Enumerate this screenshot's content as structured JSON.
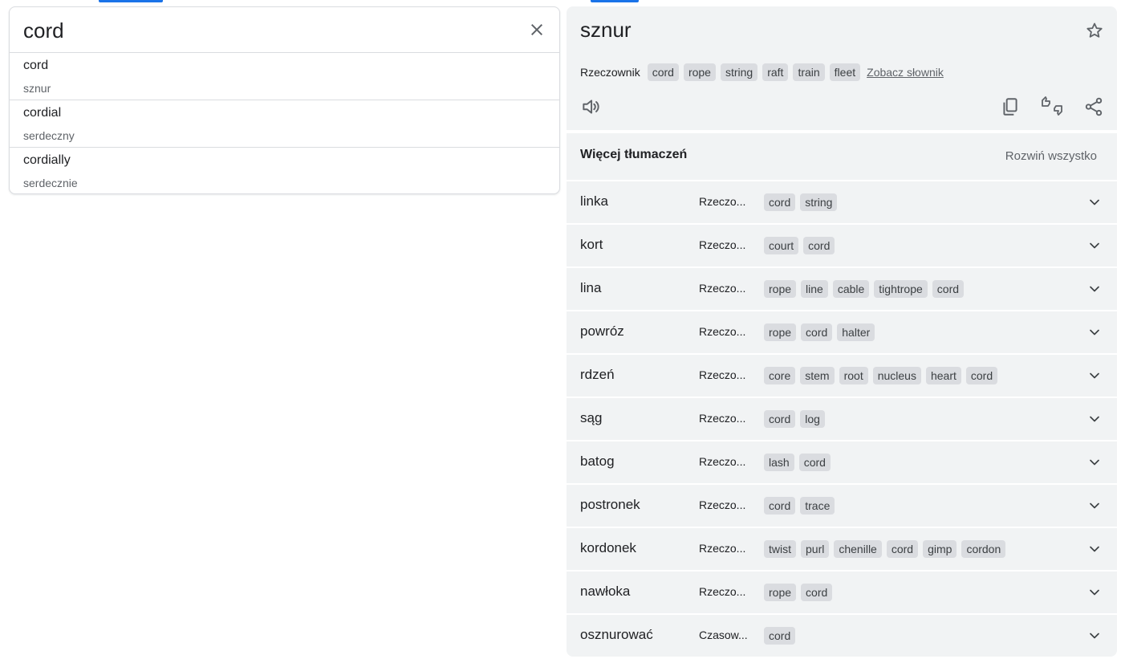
{
  "search": {
    "value": "cord",
    "suggestions": [
      {
        "term": "cord",
        "translation": "sznur"
      },
      {
        "term": "cordial",
        "translation": "serdeczny"
      },
      {
        "term": "cordially",
        "translation": "serdecznie"
      }
    ]
  },
  "result": {
    "word": "sznur",
    "part_of_speech": "Rzeczownik",
    "dictionary_chips": [
      "cord",
      "rope",
      "string",
      "raft",
      "train",
      "fleet"
    ],
    "dictionary_link": "Zobacz słownik"
  },
  "more": {
    "title": "Więcej tłumaczeń",
    "expand_all": "Rozwiń wszystko",
    "rows": [
      {
        "word": "linka",
        "pos": "Rzeczo...",
        "chips": [
          "cord",
          "string"
        ]
      },
      {
        "word": "kort",
        "pos": "Rzeczo...",
        "chips": [
          "court",
          "cord"
        ]
      },
      {
        "word": "lina",
        "pos": "Rzeczo...",
        "chips": [
          "rope",
          "line",
          "cable",
          "tightrope",
          "cord"
        ]
      },
      {
        "word": "powróz",
        "pos": "Rzeczo...",
        "chips": [
          "rope",
          "cord",
          "halter"
        ]
      },
      {
        "word": "rdzeń",
        "pos": "Rzeczo...",
        "chips": [
          "core",
          "stem",
          "root",
          "nucleus",
          "heart",
          "cord"
        ]
      },
      {
        "word": "sąg",
        "pos": "Rzeczo...",
        "chips": [
          "cord",
          "log"
        ]
      },
      {
        "word": "batog",
        "pos": "Rzeczo...",
        "chips": [
          "lash",
          "cord"
        ]
      },
      {
        "word": "postronek",
        "pos": "Rzeczo...",
        "chips": [
          "cord",
          "trace"
        ]
      },
      {
        "word": "kordonek",
        "pos": "Rzeczo...",
        "chips": [
          "twist",
          "purl",
          "chenille",
          "cord",
          "gimp",
          "cordon"
        ]
      },
      {
        "word": "nawłoka",
        "pos": "Rzeczo...",
        "chips": [
          "rope",
          "cord"
        ]
      },
      {
        "word": "osznurować",
        "pos": "Czasow...",
        "chips": [
          "cord"
        ]
      }
    ]
  },
  "icons": {
    "clear": "close-icon",
    "star": "star-icon",
    "listen": "speaker-icon",
    "copy": "copy-icon",
    "feedback": "thumbs-feedback-icon",
    "share": "share-icon",
    "expand": "chevron-down-icon"
  },
  "colors": {
    "accent": "#1a73e8",
    "panel_bg": "#f1f3f4",
    "chip_bg": "#dadce0"
  }
}
